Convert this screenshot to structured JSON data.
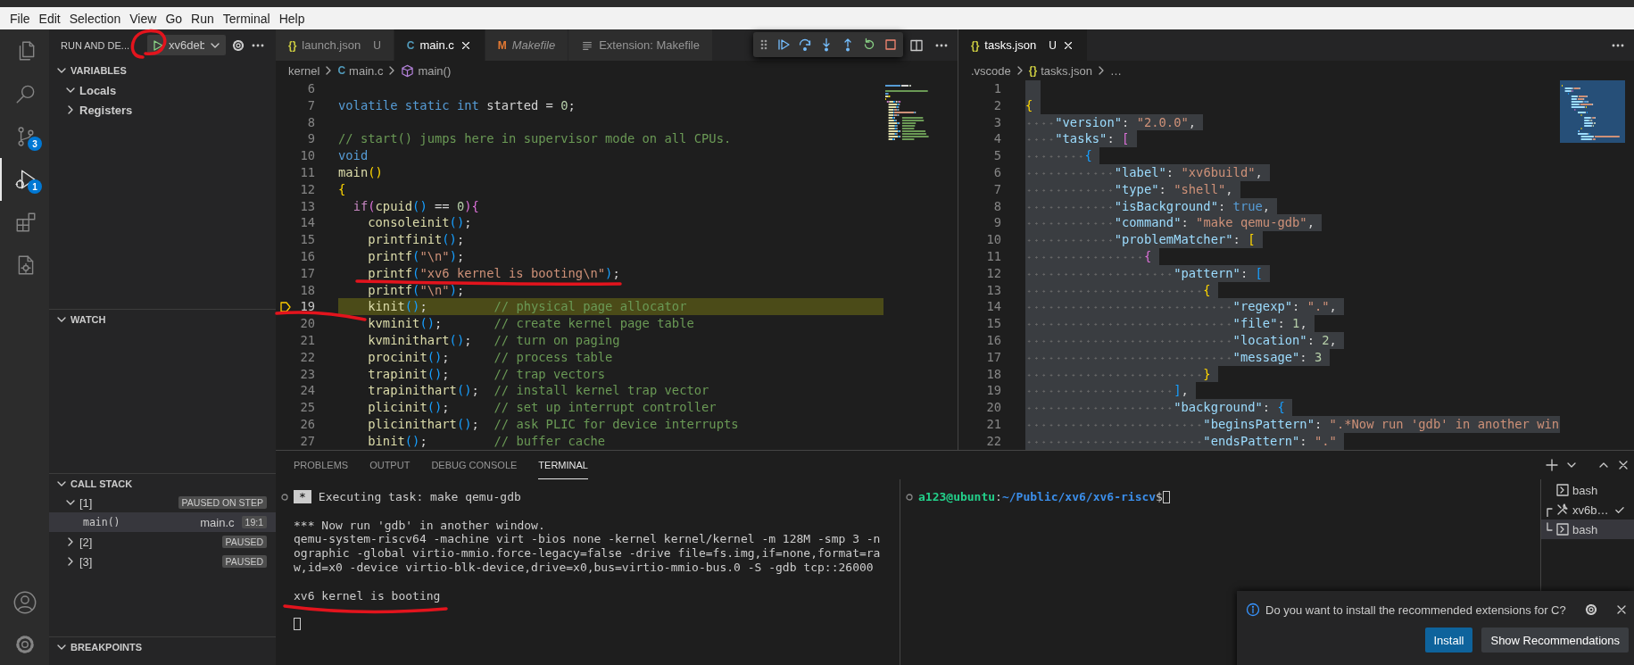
{
  "menu": [
    "File",
    "Edit",
    "Selection",
    "View",
    "Go",
    "Run",
    "Terminal",
    "Help"
  ],
  "activity_bar": [
    {
      "kind": "files",
      "selected": false
    },
    {
      "kind": "search",
      "selected": false
    },
    {
      "kind": "source-control",
      "selected": false,
      "badge": "3"
    },
    {
      "kind": "run-debug",
      "selected": true,
      "badge": "1"
    },
    {
      "kind": "extensions",
      "selected": false
    },
    {
      "kind": "file-gear",
      "selected": false
    }
  ],
  "sidebar": {
    "title": "RUN AND DE...",
    "config": "xv6deb",
    "variables": {
      "title": "VARIABLES",
      "expanded": true,
      "items": [
        {
          "label": "Locals",
          "expanded": true
        },
        {
          "label": "Registers",
          "expanded": false
        }
      ]
    },
    "watch": {
      "title": "WATCH",
      "expanded": true
    },
    "call_stack": {
      "title": "CALL STACK",
      "expanded": true,
      "threads": [
        {
          "label": "[1]",
          "status": "PAUSED ON STEP",
          "expanded": true,
          "selected": false,
          "children": [
            {
              "label": "main()",
              "file": "main.c",
              "position": "19:1",
              "selected": true
            }
          ]
        },
        {
          "label": "[2]",
          "status": "PAUSED",
          "expanded": false,
          "selected": false
        },
        {
          "label": "[3]",
          "status": "PAUSED",
          "expanded": false,
          "selected": false
        }
      ]
    },
    "breakpoints": {
      "title": "BREAKPOINTS",
      "expanded": true
    }
  },
  "editors": [
    {
      "tabs": [
        {
          "kind": "file",
          "icon": "{}",
          "color": "#cbcb41",
          "label": "launch.json",
          "status": "U",
          "selected": false,
          "preview": false
        },
        {
          "kind": "file",
          "icon": "C",
          "color": "#519aba",
          "label": "main.c",
          "selected": true,
          "preview": false
        },
        {
          "kind": "file",
          "icon": "M",
          "color": "#e37933",
          "label": "Makefile",
          "selected": false,
          "preview": true
        },
        {
          "kind": "extension",
          "label": "Extension: Makefile",
          "selected": false,
          "preview": false
        }
      ],
      "breadcrumbs": [
        {
          "kind": "folder",
          "label": "kernel"
        },
        {
          "kind": "file",
          "icon": "C",
          "color": "#519aba",
          "label": "main.c"
        },
        {
          "kind": "symbol",
          "label": "main()"
        }
      ],
      "lines": [
        {
          "n": "6",
          "current": false
        },
        {
          "n": "7",
          "current": false,
          "tokens": [
            {
              "kind": "kw",
              "text": "volatile static int "
            },
            {
              "kind": "p",
              "text": "started = "
            },
            {
              "kind": "num",
              "text": "0"
            },
            {
              "kind": "p",
              "text": ";"
            }
          ]
        },
        {
          "n": "8",
          "current": false
        },
        {
          "n": "9",
          "current": false,
          "tokens": [
            {
              "kind": "com",
              "text": "// start() jumps here in supervisor mode on all CPUs."
            }
          ]
        },
        {
          "n": "10",
          "current": false,
          "tokens": [
            {
              "kind": "kw",
              "text": "void"
            }
          ]
        },
        {
          "n": "11",
          "current": false,
          "tokens": [
            {
              "kind": "fn",
              "text": "main"
            },
            {
              "kind": "b1",
              "text": "()"
            }
          ]
        },
        {
          "n": "12",
          "current": false,
          "tokens": [
            {
              "kind": "b1",
              "text": "{"
            }
          ]
        },
        {
          "n": "13",
          "current": false,
          "tokens": [
            {
              "kind": "ctl",
              "text": "  if"
            },
            {
              "kind": "b2",
              "text": "("
            },
            {
              "kind": "fn",
              "text": "cpuid"
            },
            {
              "kind": "b3",
              "text": "()"
            },
            {
              "kind": "p",
              "text": " == "
            },
            {
              "kind": "num",
              "text": "0"
            },
            {
              "kind": "b2",
              "text": ")"
            },
            {
              "kind": "b2",
              "text": "{"
            }
          ]
        },
        {
          "n": "14",
          "current": false,
          "tokens": [
            {
              "kind": "fn",
              "text": "    consoleinit"
            },
            {
              "kind": "b3",
              "text": "()"
            },
            {
              "kind": "p",
              "text": ";"
            }
          ]
        },
        {
          "n": "15",
          "current": false,
          "tokens": [
            {
              "kind": "fn",
              "text": "    printfinit"
            },
            {
              "kind": "b3",
              "text": "()"
            },
            {
              "kind": "p",
              "text": ";"
            }
          ]
        },
        {
          "n": "16",
          "current": false,
          "tokens": [
            {
              "kind": "fn",
              "text": "    printf"
            },
            {
              "kind": "b3",
              "text": "("
            },
            {
              "kind": "str",
              "text": "\"\\n\""
            },
            {
              "kind": "b3",
              "text": ")"
            },
            {
              "kind": "p",
              "text": ";"
            }
          ]
        },
        {
          "n": "17",
          "current": false,
          "tokens": [
            {
              "kind": "fn",
              "text": "    printf"
            },
            {
              "kind": "b3",
              "text": "("
            },
            {
              "kind": "str",
              "text": "\"xv6 kernel is booting\\n\""
            },
            {
              "kind": "b3",
              "text": ")"
            },
            {
              "kind": "p",
              "text": ";"
            }
          ]
        },
        {
          "n": "18",
          "current": false,
          "tokens": [
            {
              "kind": "fn",
              "text": "    printf"
            },
            {
              "kind": "b3",
              "text": "("
            },
            {
              "kind": "str",
              "text": "\"\\n\""
            },
            {
              "kind": "b3",
              "text": ")"
            },
            {
              "kind": "p",
              "text": ";"
            }
          ]
        },
        {
          "n": "19",
          "current": true,
          "tokens": [
            {
              "kind": "fn",
              "text": "    kinit"
            },
            {
              "kind": "b3",
              "text": "()"
            },
            {
              "kind": "p",
              "text": ";         "
            },
            {
              "kind": "com",
              "text": "// physical page allocator"
            }
          ]
        },
        {
          "n": "20",
          "current": false,
          "tokens": [
            {
              "kind": "fn",
              "text": "    kvminit"
            },
            {
              "kind": "b3",
              "text": "()"
            },
            {
              "kind": "p",
              "text": ";       "
            },
            {
              "kind": "com",
              "text": "// create kernel page table"
            }
          ]
        },
        {
          "n": "21",
          "current": false,
          "tokens": [
            {
              "kind": "fn",
              "text": "    kvminithart"
            },
            {
              "kind": "b3",
              "text": "()"
            },
            {
              "kind": "p",
              "text": ";   "
            },
            {
              "kind": "com",
              "text": "// turn on paging"
            }
          ]
        },
        {
          "n": "22",
          "current": false,
          "tokens": [
            {
              "kind": "fn",
              "text": "    procinit"
            },
            {
              "kind": "b3",
              "text": "()"
            },
            {
              "kind": "p",
              "text": ";      "
            },
            {
              "kind": "com",
              "text": "// process table"
            }
          ]
        },
        {
          "n": "23",
          "current": false,
          "tokens": [
            {
              "kind": "fn",
              "text": "    trapinit"
            },
            {
              "kind": "b3",
              "text": "()"
            },
            {
              "kind": "p",
              "text": ";      "
            },
            {
              "kind": "com",
              "text": "// trap vectors"
            }
          ]
        },
        {
          "n": "24",
          "current": false,
          "tokens": [
            {
              "kind": "fn",
              "text": "    trapinithart"
            },
            {
              "kind": "b3",
              "text": "()"
            },
            {
              "kind": "p",
              "text": ";  "
            },
            {
              "kind": "com",
              "text": "// install kernel trap vector"
            }
          ]
        },
        {
          "n": "25",
          "current": false,
          "tokens": [
            {
              "kind": "fn",
              "text": "    plicinit"
            },
            {
              "kind": "b3",
              "text": "()"
            },
            {
              "kind": "p",
              "text": ";      "
            },
            {
              "kind": "com",
              "text": "// set up interrupt controller"
            }
          ]
        },
        {
          "n": "26",
          "current": false,
          "tokens": [
            {
              "kind": "fn",
              "text": "    plicinithart"
            },
            {
              "kind": "b3",
              "text": "()"
            },
            {
              "kind": "p",
              "text": ";  "
            },
            {
              "kind": "com",
              "text": "// ask PLIC for device interrupts"
            }
          ]
        },
        {
          "n": "27",
          "current": false,
          "tokens": [
            {
              "kind": "fn",
              "text": "    binit"
            },
            {
              "kind": "b3",
              "text": "()"
            },
            {
              "kind": "p",
              "text": ";         "
            },
            {
              "kind": "com",
              "text": "// buffer cache"
            }
          ]
        }
      ]
    },
    {
      "tabs": [
        {
          "kind": "file",
          "icon": "{}",
          "color": "#cbcb41",
          "label": "tasks.json",
          "status": "U",
          "selected": true,
          "preview": false
        }
      ],
      "breadcrumbs": [
        {
          "kind": "folder",
          "label": ".vscode"
        },
        {
          "kind": "file",
          "icon": "{}",
          "color": "#cbcb41",
          "label": "tasks.json"
        },
        {
          "kind": "more",
          "label": "…"
        }
      ],
      "all_selected": true,
      "lines": [
        {
          "n": "1"
        },
        {
          "n": "2",
          "tokens": [
            {
              "kind": "b1",
              "text": "{"
            }
          ]
        },
        {
          "n": "3",
          "tokens": [
            {
              "kind": "key",
              "text": "    \"version\""
            },
            {
              "kind": "p",
              "text": ": "
            },
            {
              "kind": "str",
              "text": "\"2.0.0\""
            },
            {
              "kind": "p",
              "text": ","
            }
          ]
        },
        {
          "n": "4",
          "tokens": [
            {
              "kind": "key",
              "text": "    \"tasks\""
            },
            {
              "kind": "p",
              "text": ": "
            },
            {
              "kind": "b2",
              "text": "["
            }
          ]
        },
        {
          "n": "5",
          "tokens": [
            {
              "kind": "b3",
              "text": "        {"
            }
          ]
        },
        {
          "n": "6",
          "tokens": [
            {
              "kind": "key",
              "text": "            \"label\""
            },
            {
              "kind": "p",
              "text": ": "
            },
            {
              "kind": "str",
              "text": "\"xv6build\""
            },
            {
              "kind": "p",
              "text": ","
            }
          ]
        },
        {
          "n": "7",
          "tokens": [
            {
              "kind": "key",
              "text": "            \"type\""
            },
            {
              "kind": "p",
              "text": ": "
            },
            {
              "kind": "str",
              "text": "\"shell\""
            },
            {
              "kind": "p",
              "text": ","
            }
          ]
        },
        {
          "n": "8",
          "tokens": [
            {
              "kind": "key",
              "text": "            \"isBackground\""
            },
            {
              "kind": "p",
              "text": ": "
            },
            {
              "kind": "kw",
              "text": "true"
            },
            {
              "kind": "p",
              "text": ","
            }
          ]
        },
        {
          "n": "9",
          "tokens": [
            {
              "kind": "key",
              "text": "            \"command\""
            },
            {
              "kind": "p",
              "text": ": "
            },
            {
              "kind": "str",
              "text": "\"make qemu-gdb\""
            },
            {
              "kind": "p",
              "text": ","
            }
          ]
        },
        {
          "n": "10",
          "tokens": [
            {
              "kind": "key",
              "text": "            \"problemMatcher\""
            },
            {
              "kind": "p",
              "text": ": "
            },
            {
              "kind": "b1",
              "text": "["
            }
          ]
        },
        {
          "n": "11",
          "tokens": [
            {
              "kind": "b2",
              "text": "                {"
            }
          ]
        },
        {
          "n": "12",
          "tokens": [
            {
              "kind": "key",
              "text": "                    \"pattern\""
            },
            {
              "kind": "p",
              "text": ": "
            },
            {
              "kind": "b3",
              "text": "["
            }
          ]
        },
        {
          "n": "13",
          "tokens": [
            {
              "kind": "b1",
              "text": "                        {"
            }
          ]
        },
        {
          "n": "14",
          "tokens": [
            {
              "kind": "key",
              "text": "                            \"regexp\""
            },
            {
              "kind": "p",
              "text": ": "
            },
            {
              "kind": "str",
              "text": "\".\""
            },
            {
              "kind": "p",
              "text": ","
            }
          ]
        },
        {
          "n": "15",
          "tokens": [
            {
              "kind": "key",
              "text": "                            \"file\""
            },
            {
              "kind": "p",
              "text": ": "
            },
            {
              "kind": "num",
              "text": "1"
            },
            {
              "kind": "p",
              "text": ","
            }
          ]
        },
        {
          "n": "16",
          "tokens": [
            {
              "kind": "key",
              "text": "                            \"location\""
            },
            {
              "kind": "p",
              "text": ": "
            },
            {
              "kind": "num",
              "text": "2"
            },
            {
              "kind": "p",
              "text": ","
            }
          ]
        },
        {
          "n": "17",
          "tokens": [
            {
              "kind": "key",
              "text": "                            \"message\""
            },
            {
              "kind": "p",
              "text": ": "
            },
            {
              "kind": "num",
              "text": "3"
            }
          ]
        },
        {
          "n": "18",
          "tokens": [
            {
              "kind": "b1",
              "text": "                        }"
            }
          ]
        },
        {
          "n": "19",
          "tokens": [
            {
              "kind": "b3",
              "text": "                    ]"
            },
            {
              "kind": "p",
              "text": ","
            }
          ]
        },
        {
          "n": "20",
          "tokens": [
            {
              "kind": "key",
              "text": "                    \"background\""
            },
            {
              "kind": "p",
              "text": ": "
            },
            {
              "kind": "b3",
              "text": "{"
            }
          ]
        },
        {
          "n": "21",
          "tokens": [
            {
              "kind": "key",
              "text": "                        \"beginsPattern\""
            },
            {
              "kind": "p",
              "text": ": "
            },
            {
              "kind": "str",
              "text": "\".*Now run 'gdb' in another win"
            }
          ]
        },
        {
          "n": "22",
          "tokens": [
            {
              "kind": "key",
              "text": "                        \"endsPattern\""
            },
            {
              "kind": "p",
              "text": ": "
            },
            {
              "kind": "str",
              "text": "\".\""
            }
          ]
        }
      ]
    }
  ],
  "panel": {
    "tabs": [
      {
        "label": "PROBLEMS",
        "selected": false
      },
      {
        "label": "OUTPUT",
        "selected": false
      },
      {
        "label": "DEBUG CONSOLE",
        "selected": false
      },
      {
        "label": "TERMINAL",
        "selected": true
      }
    ],
    "terminals": [
      {
        "task_badge": "*",
        "task": "Executing task: make qemu-gdb",
        "output": [
          [
            "*** Now run 'gdb' in another window.",
            "qemu-system-riscv64 -machine virt -bios none -kernel kernel/kernel -m 128M -smp 3 -n",
            "ographic -global virtio-mmio.force-legacy=false -drive file=fs.img,if=none,format=ra",
            "w,id=x0 -device virtio-blk-device,drive=x0,bus=virtio-mmio-bus.0 -S -gdb tcp::26000"
          ],
          [
            "xv6 kernel is booting"
          ]
        ],
        "cursor": true
      },
      {
        "prompt": {
          "user": "a123@ubuntu",
          "separator": ":",
          "path": "~/Public/xv6/xv6-riscv",
          "end": "$"
        },
        "cursor": true
      }
    ],
    "terminal_list": [
      {
        "kind": "shell",
        "label": "bash",
        "selected": false,
        "done": false
      },
      {
        "kind": "task",
        "label": "xv6b…",
        "selected": false,
        "done": true,
        "children": [
          {
            "kind": "shell",
            "label": "bash",
            "selected": true,
            "done": false
          }
        ]
      }
    ]
  },
  "notification": {
    "message": "Do you want to install the recommended extensions for C?",
    "buttons": [
      {
        "label": "Install",
        "primary": true
      },
      {
        "label": "Show Recommendations",
        "primary": false
      }
    ]
  }
}
